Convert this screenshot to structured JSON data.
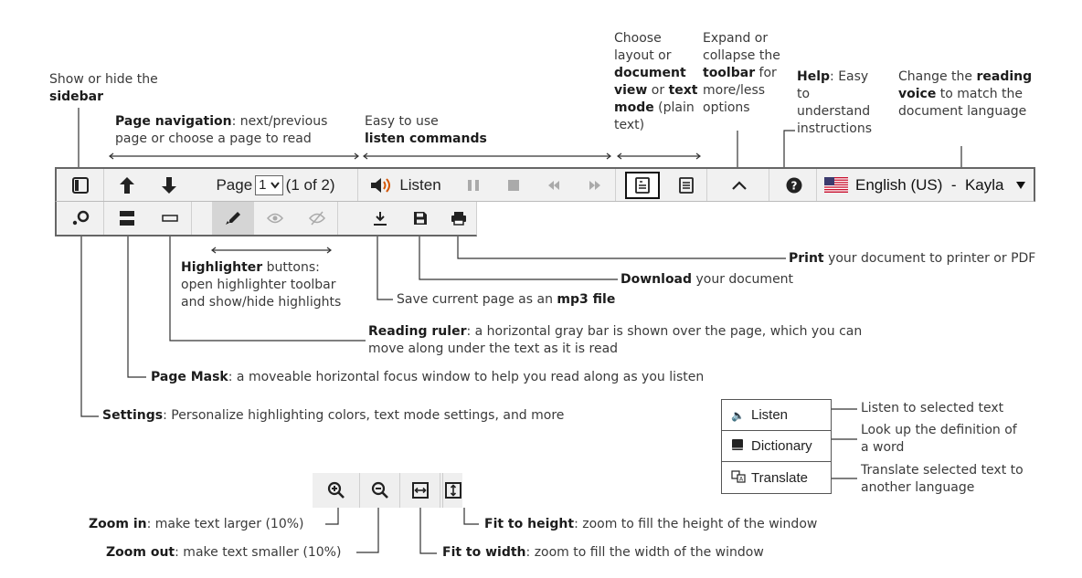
{
  "annotations": {
    "sidebar": {
      "text": "Show or hide the ",
      "bold": "sidebar"
    },
    "page_nav": {
      "bold": "Page navigation",
      "text": ": next/previous page or choose a page to read"
    },
    "listen_cmds": {
      "text": "Easy to use ",
      "bold": "listen commands"
    },
    "layout": {
      "t1": "Choose layout or ",
      "b1": "document view",
      "t2": " or ",
      "b2": "text mode",
      "t3": " (plain text)"
    },
    "expand": {
      "t1": "Expand or collapse the ",
      "b1": "toolbar",
      "t2": " for more/less options"
    },
    "help": {
      "bold": "Help",
      "text": ": Easy to understand instructions"
    },
    "voice": {
      "t1": "Change the ",
      "b1": "reading voice",
      "t2": " to match the document language"
    },
    "highlighter": {
      "bold": "Highlighter",
      "text": " buttons: open highlighter toolbar and show/hide highlights"
    },
    "print": {
      "bold": "Print",
      "text": " your document to printer or PDF"
    },
    "download": {
      "bold": "Download",
      "text": " your document"
    },
    "mp3": {
      "text": "Save current page as an ",
      "bold": "mp3 file"
    },
    "ruler": {
      "bold": "Reading ruler",
      "text": ": a horizontal gray bar is shown over the page, which you can move along under the text as it is read"
    },
    "mask": {
      "bold": "Page Mask",
      "text": ": a moveable horizontal focus window to help you read along as you listen"
    },
    "settings": {
      "bold": "Settings",
      "text": ": Personalize highlighting colors, text mode settings, and more"
    },
    "zoom_in": {
      "bold": "Zoom in",
      "text": ": make text larger (10%)"
    },
    "zoom_out": {
      "bold": "Zoom out",
      "text": ": make text smaller (10%)"
    },
    "fit_height": {
      "bold": "Fit to height",
      "text": ": zoom to fill the height of the window"
    },
    "fit_width": {
      "bold": "Fit to width",
      "text": ": zoom to fill the width of the window"
    },
    "ctx_listen": "Listen to selected text",
    "ctx_dict": "Look up the definition of a word",
    "ctx_translate": "Translate selected text to another language"
  },
  "toolbar": {
    "page_label": "Page",
    "page_value": "1",
    "page_total": "(1 of 2)",
    "listen_label": "Listen",
    "voice_label": "English (US)  -  Kayla"
  },
  "context_menu": {
    "listen": "Listen",
    "dictionary": "Dictionary",
    "translate": "Translate"
  },
  "colors": {
    "toolbar_bg": "#f1f1f1",
    "listen_icon": "#d35400"
  },
  "icons": [
    "sidebar-icon",
    "arrow-up-icon",
    "arrow-down-icon",
    "chevron-down-icon",
    "speaker-icon",
    "pause-icon",
    "stop-icon",
    "rewind-icon",
    "fast-forward-icon",
    "document-view-icon",
    "text-mode-icon",
    "chevron-up-icon",
    "help-icon",
    "us-flag-icon",
    "dropdown-arrow-icon",
    "settings-icon",
    "page-mask-icon",
    "reading-ruler-icon",
    "highlighter-icon",
    "eye-icon",
    "eye-off-icon",
    "download-mp3-icon",
    "save-icon",
    "print-icon",
    "zoom-in-icon",
    "zoom-out-icon",
    "fit-width-icon",
    "fit-height-icon",
    "dictionary-icon",
    "translate-icon"
  ]
}
